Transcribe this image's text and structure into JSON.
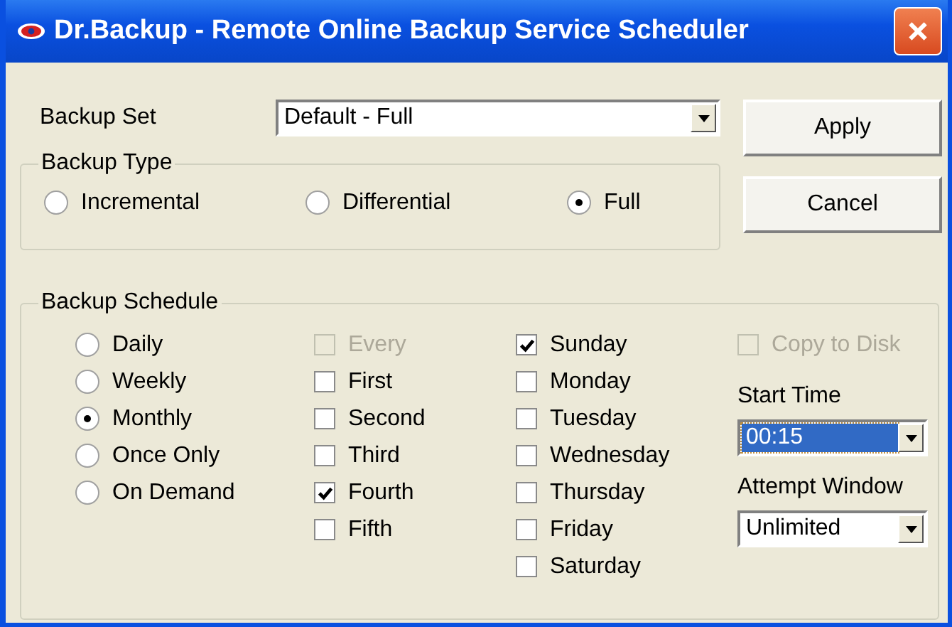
{
  "window": {
    "title": "Dr.Backup - Remote Online Backup Service  Scheduler"
  },
  "backup_set": {
    "label": "Backup Set",
    "value": "Default - Full"
  },
  "buttons": [
    {
      "label": "Apply"
    },
    {
      "label": "Cancel"
    }
  ],
  "backup_type": {
    "label": "Backup Type",
    "options": [
      {
        "label": "Incremental",
        "selected": false
      },
      {
        "label": "Differential",
        "selected": false
      },
      {
        "label": "Full",
        "selected": true
      }
    ]
  },
  "schedule": {
    "label": "Backup Schedule",
    "frequency": [
      {
        "label": "Daily",
        "selected": false
      },
      {
        "label": "Weekly",
        "selected": false
      },
      {
        "label": "Monthly",
        "selected": true
      },
      {
        "label": "Once Only",
        "selected": false
      },
      {
        "label": "On Demand",
        "selected": false
      }
    ],
    "weeks": [
      {
        "label": "Every",
        "checked": false,
        "disabled": true
      },
      {
        "label": "First",
        "checked": false,
        "disabled": false
      },
      {
        "label": "Second",
        "checked": false,
        "disabled": false
      },
      {
        "label": "Third",
        "checked": false,
        "disabled": false
      },
      {
        "label": "Fourth",
        "checked": true,
        "disabled": false
      },
      {
        "label": "Fifth",
        "checked": false,
        "disabled": false
      }
    ],
    "days": [
      {
        "label": "Sunday",
        "checked": true,
        "disabled": false
      },
      {
        "label": "Monday",
        "checked": false,
        "disabled": false
      },
      {
        "label": "Tuesday",
        "checked": false,
        "disabled": false
      },
      {
        "label": "Wednesday",
        "checked": false,
        "disabled": false
      },
      {
        "label": "Thursday",
        "checked": false,
        "disabled": false
      },
      {
        "label": "Friday",
        "checked": false,
        "disabled": false
      },
      {
        "label": "Saturday",
        "checked": false,
        "disabled": false
      }
    ],
    "copy_to_disk": {
      "label": "Copy to Disk",
      "checked": false,
      "disabled": true
    },
    "start_time": {
      "label": "Start Time",
      "value": "00:15",
      "focused": true
    },
    "attempt_window": {
      "label": "Attempt Window",
      "value": "Unlimited",
      "focused": false
    }
  }
}
